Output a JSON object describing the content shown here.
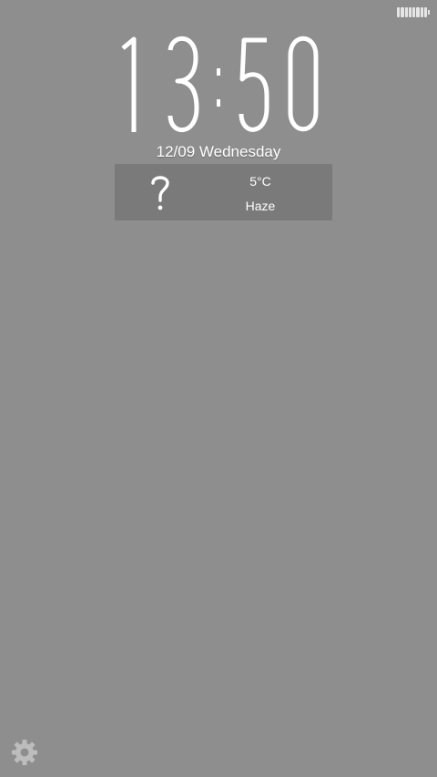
{
  "status_bar": {
    "battery_level": 1.0
  },
  "clock": {
    "time": "13:50"
  },
  "date": {
    "text": "12/09 Wednesday"
  },
  "weather": {
    "temperature": "5°C",
    "condition": "Haze",
    "icon": "question-mark-icon"
  },
  "footer": {
    "settings_icon": "gear-icon"
  },
  "colors": {
    "background": "#8e8e8e",
    "weather_panel": "#7a7a7a",
    "text": "#ffffff"
  }
}
